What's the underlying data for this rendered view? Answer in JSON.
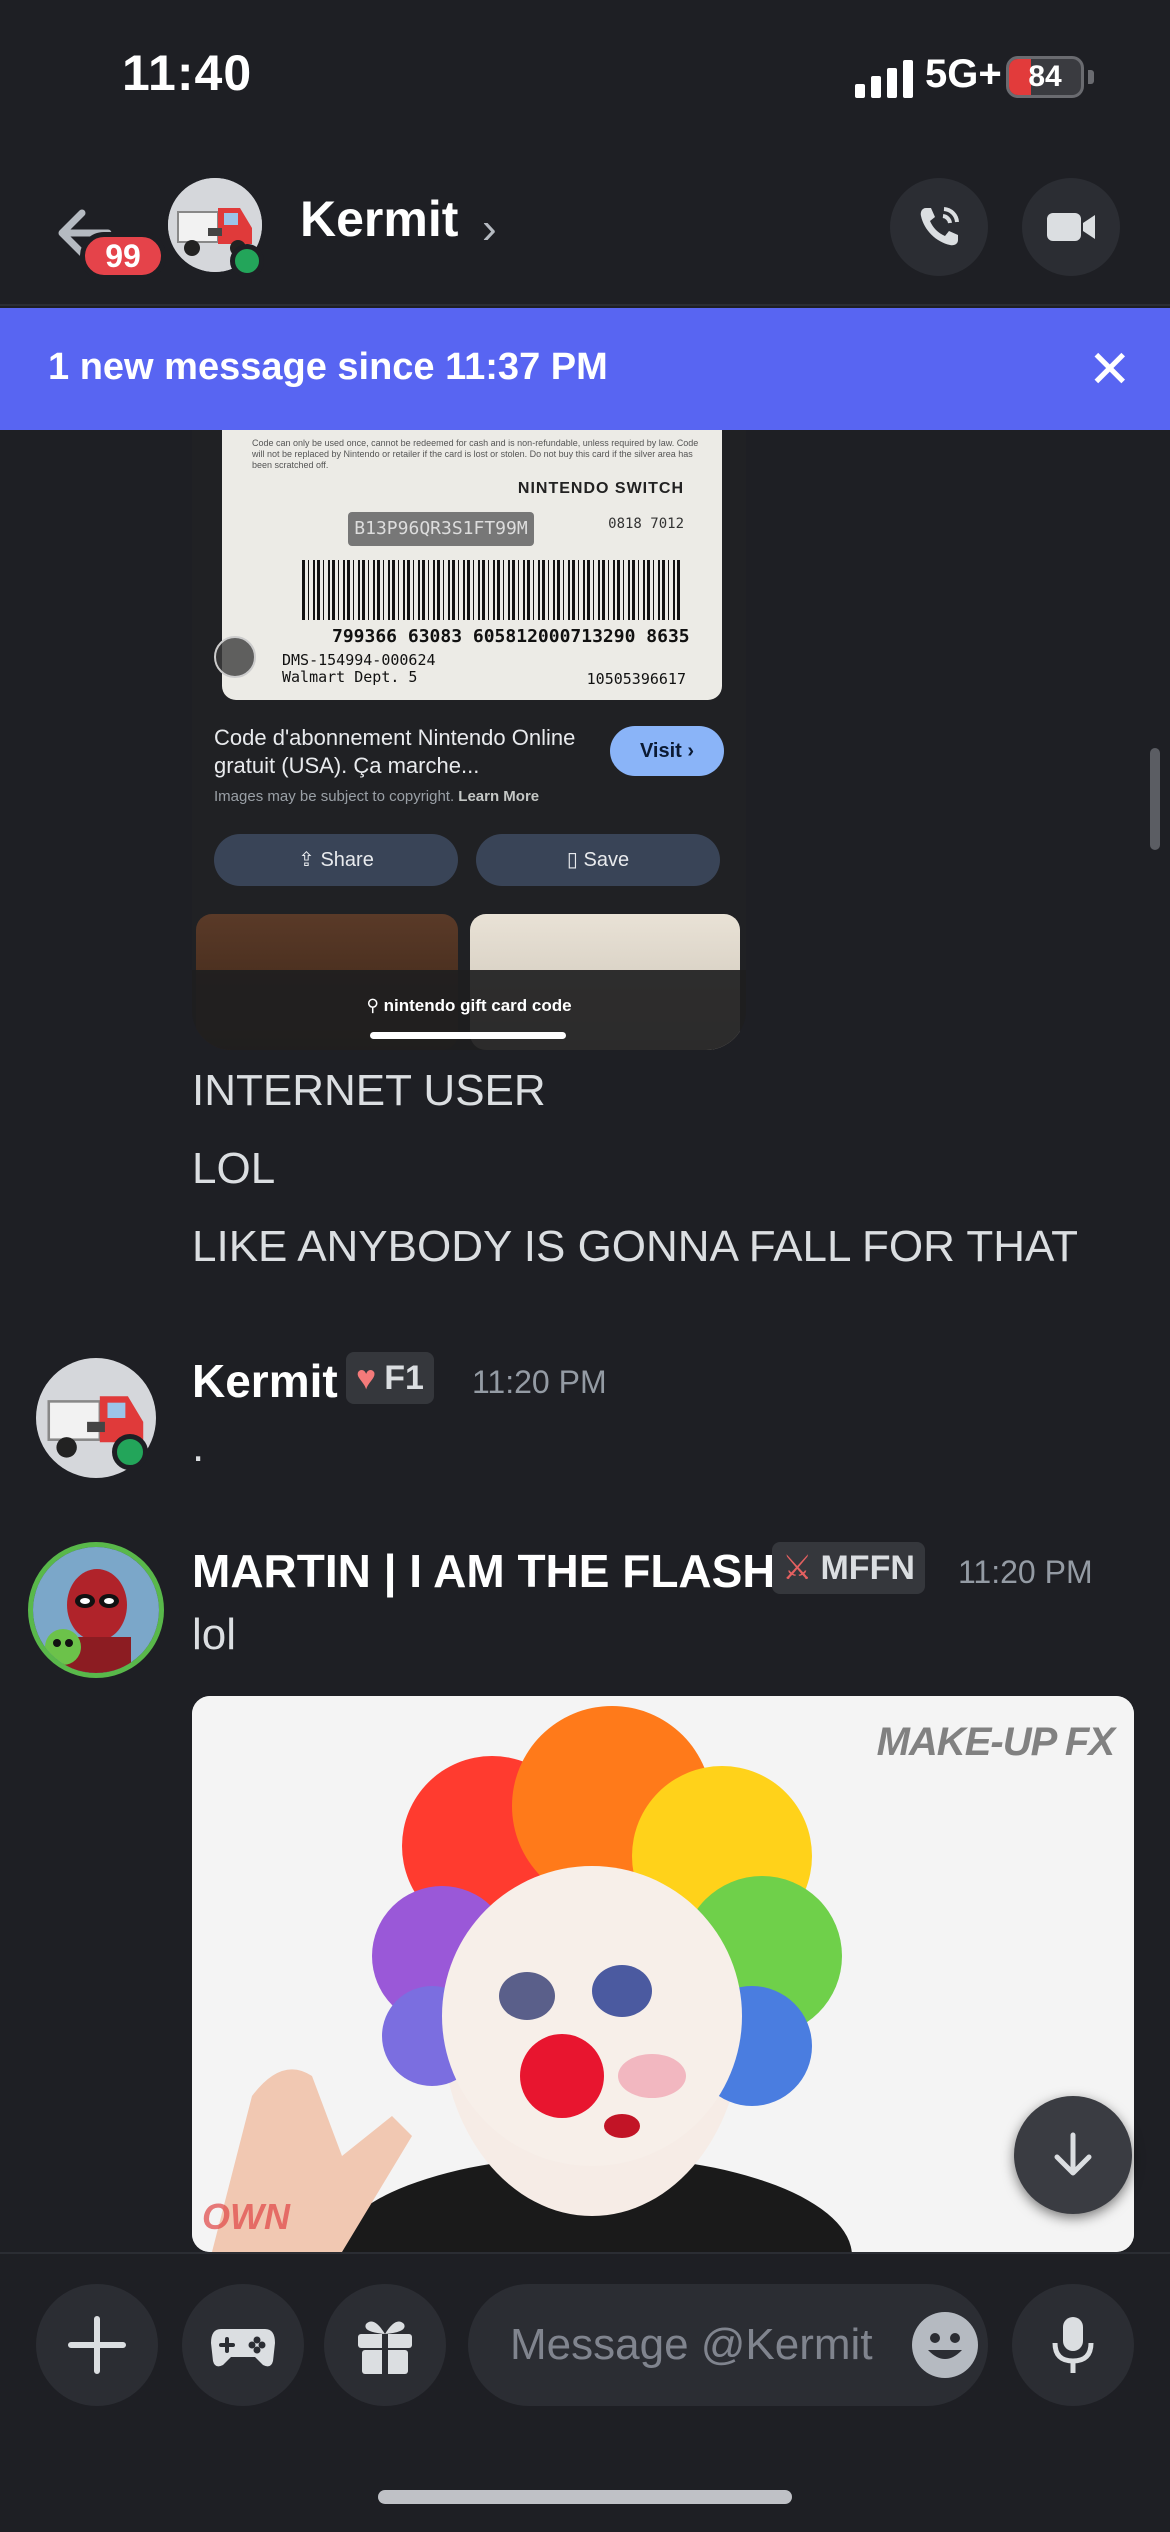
{
  "status_bar": {
    "time": "11:40",
    "network": "5G+",
    "battery": "84",
    "battery_level_pct": 30
  },
  "header": {
    "unread_count": "99",
    "name": "Kermit",
    "chevron": "›",
    "icons": [
      "back-arrow-icon",
      "phone-call-icon",
      "video-camera-icon",
      "chevron-right-icon"
    ]
  },
  "banner": {
    "text": "1 new message since 11:37 PM",
    "close": "✕"
  },
  "screenshot_card": {
    "gift_fineprint": "Code can only be used once, cannot be redeemed for cash and is non-refundable, unless required by law. Code will not be replaced by Nintendo or retailer if the card is lost or stolen. Do not buy this card if the silver area has been scratched off.",
    "gift_brand": "NINTENDO SWITCH",
    "gift_code": "B13P96QR3S1FT99M",
    "gift_small": "0818 7012",
    "gift_number": "799366 63083 605812000713290 8635",
    "gift_store": "DMS-154994-000624\nWalmart Dept. 5",
    "gift_serial": "10505396617",
    "title": "Code d'abonnement Nintendo Online gratuit (USA). Ça marche...",
    "visit_label": "Visit ›",
    "note": "Images may be subject to copyright.",
    "note_link": "Learn More",
    "share_label": "⇪ Share",
    "save_label": "▯ Save",
    "search_query": "⚲ nintendo gift card code"
  },
  "messages": {
    "continuation_lines": [
      "INTERNET USER",
      "LOL",
      "LIKE ANYBODY IS GONNA FALL FOR THAT"
    ],
    "kermit": {
      "author": "Kermit",
      "tag": "F1",
      "tag_icon": "♥",
      "time": "11:20 PM",
      "text": "."
    },
    "martin": {
      "author": "MARTIN | I AM THE FLASH",
      "tag": "MFFN",
      "tag_icon": "⚔",
      "time": "11:20 PM",
      "text": "lol"
    }
  },
  "media": {
    "watermark": "MAKE-UP FX",
    "watermark2": "OWN"
  },
  "composer": {
    "placeholder": "Message @Kermit",
    "icons": [
      "plus-icon",
      "gamepad-icon",
      "gift-icon",
      "emoji-icon",
      "microphone-icon"
    ]
  },
  "colors": {
    "accent": "#5865f2",
    "badge": "#e5434a",
    "online": "#23a55a",
    "background": "#1e1f24"
  }
}
